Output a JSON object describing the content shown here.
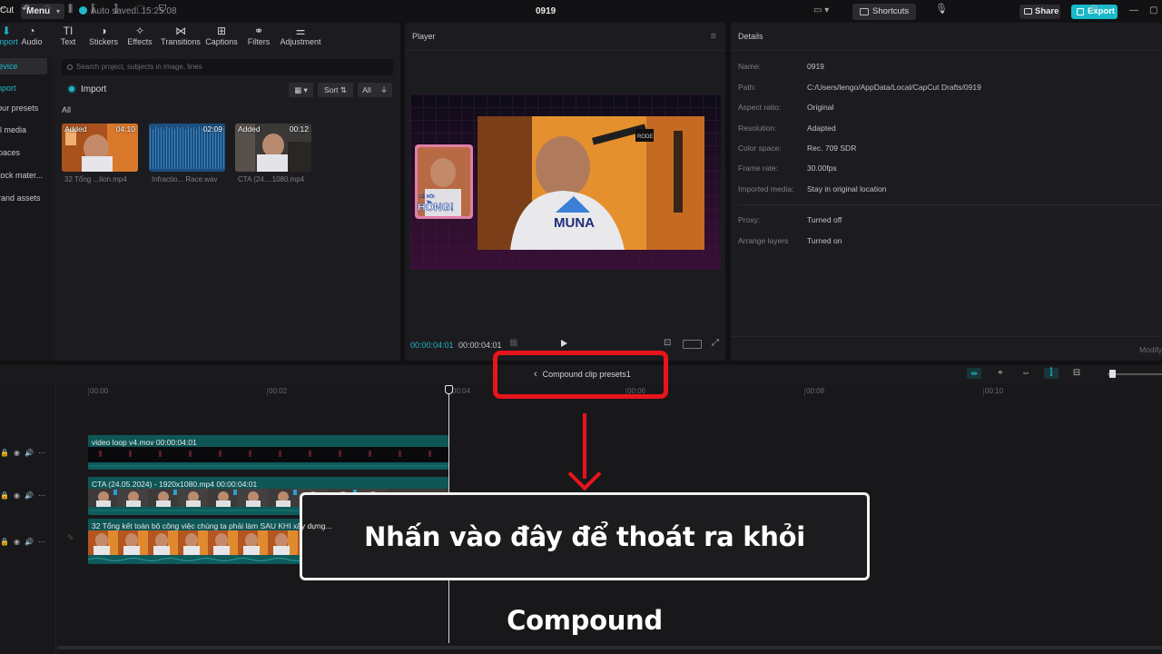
{
  "titlebar": {
    "app_logo": "Cut",
    "menu_label": "Menu",
    "autosave": "Auto saved: 15:25:08",
    "project_title": "0919",
    "shortcuts_label": "Shortcuts",
    "share_label": "Share",
    "export_label": "Export"
  },
  "media": {
    "tabs": [
      {
        "label": "Import",
        "icon": "import-icon",
        "glyph": "⬇"
      },
      {
        "label": "Audio",
        "icon": "audio-icon",
        "glyph": "◔"
      },
      {
        "label": "Text",
        "icon": "text-icon",
        "glyph": "TI"
      },
      {
        "label": "Stickers",
        "icon": "sticker-icon",
        "glyph": "◑"
      },
      {
        "label": "Effects",
        "icon": "effects-icon",
        "glyph": "✧"
      },
      {
        "label": "Transitions",
        "icon": "transitions-icon",
        "glyph": "⋈"
      },
      {
        "label": "Captions",
        "icon": "captions-icon",
        "glyph": "⊞"
      },
      {
        "label": "Filters",
        "icon": "filters-icon",
        "glyph": "⚭"
      },
      {
        "label": "Adjustment",
        "icon": "adjustment-icon",
        "glyph": "⚌"
      }
    ],
    "side_nav": [
      {
        "label": "Device"
      },
      {
        "label": "Import"
      },
      {
        "label": "Your presets"
      },
      {
        "label": "All media"
      },
      {
        "label": "Spaces"
      },
      {
        "label": "Stock mater..."
      },
      {
        "label": "Brand assets"
      }
    ],
    "search_placeholder": "Search project, subjects in image, lines",
    "import_label": "Import",
    "sort_label": "Sort",
    "filter_all_label": "All",
    "section_all": "All",
    "items": [
      {
        "badge": "Added",
        "duration": "04:10",
        "name": "32 Tổng ...tion.mp4"
      },
      {
        "badge": "",
        "duration": "02:09",
        "name": "Infractio... Race.wav"
      },
      {
        "badge": "Added",
        "duration": "00:12",
        "name": "CTA (24....1080.mp4"
      }
    ]
  },
  "player": {
    "title": "Player",
    "timecode_current": "00:00:04:01",
    "timecode_total": "00:00:04:01",
    "video_texts": {
      "caption_left": "HỒNG!",
      "caption_small": "LÊ HỒI",
      "shirt": "MUNA",
      "mic_brand": "RODE"
    }
  },
  "details": {
    "title": "Details",
    "rows": [
      {
        "key": "Name:",
        "value": "0919"
      },
      {
        "key": "Path:",
        "value": "C:/Users/lengo/AppData/Local/CapCut Drafts/0919"
      },
      {
        "key": "Aspect ratio:",
        "value": "Original"
      },
      {
        "key": "Resolution:",
        "value": "Adapted"
      },
      {
        "key": "Color space:",
        "value": "Rec. 709 SDR"
      },
      {
        "key": "Frame rate:",
        "value": "30.00fps"
      },
      {
        "key": "Imported media:",
        "value": "Stay in original location"
      }
    ],
    "rows2": [
      {
        "key": "Proxy:",
        "value": "Turned off"
      },
      {
        "key": "Arrange layers",
        "value": "Turned on"
      }
    ],
    "modify_label": "Modify"
  },
  "timeline": {
    "breadcrumb": "Compound clip presets1",
    "ruler": [
      "00:00",
      "00:02",
      "00:04",
      "00:06",
      "00:08",
      "00:10"
    ],
    "clips": [
      {
        "label": "video loop v4.mov  00:00:04:01"
      },
      {
        "label": "CTA (24.05.2024) - 1920x1080.mp4  00:00:04:01"
      },
      {
        "label": "32 Tổng kết toàn bộ công việc chúng ta phải làm SAU KHI xây dựng..."
      }
    ]
  },
  "annotation": {
    "callout_text": "Nhấn vào đây để thoát ra khỏi Compound",
    "color": "#e8141b"
  },
  "colors": {
    "accent": "#1fb8c9",
    "panel_bg": "#1c1c20",
    "app_bg": "#111113"
  }
}
